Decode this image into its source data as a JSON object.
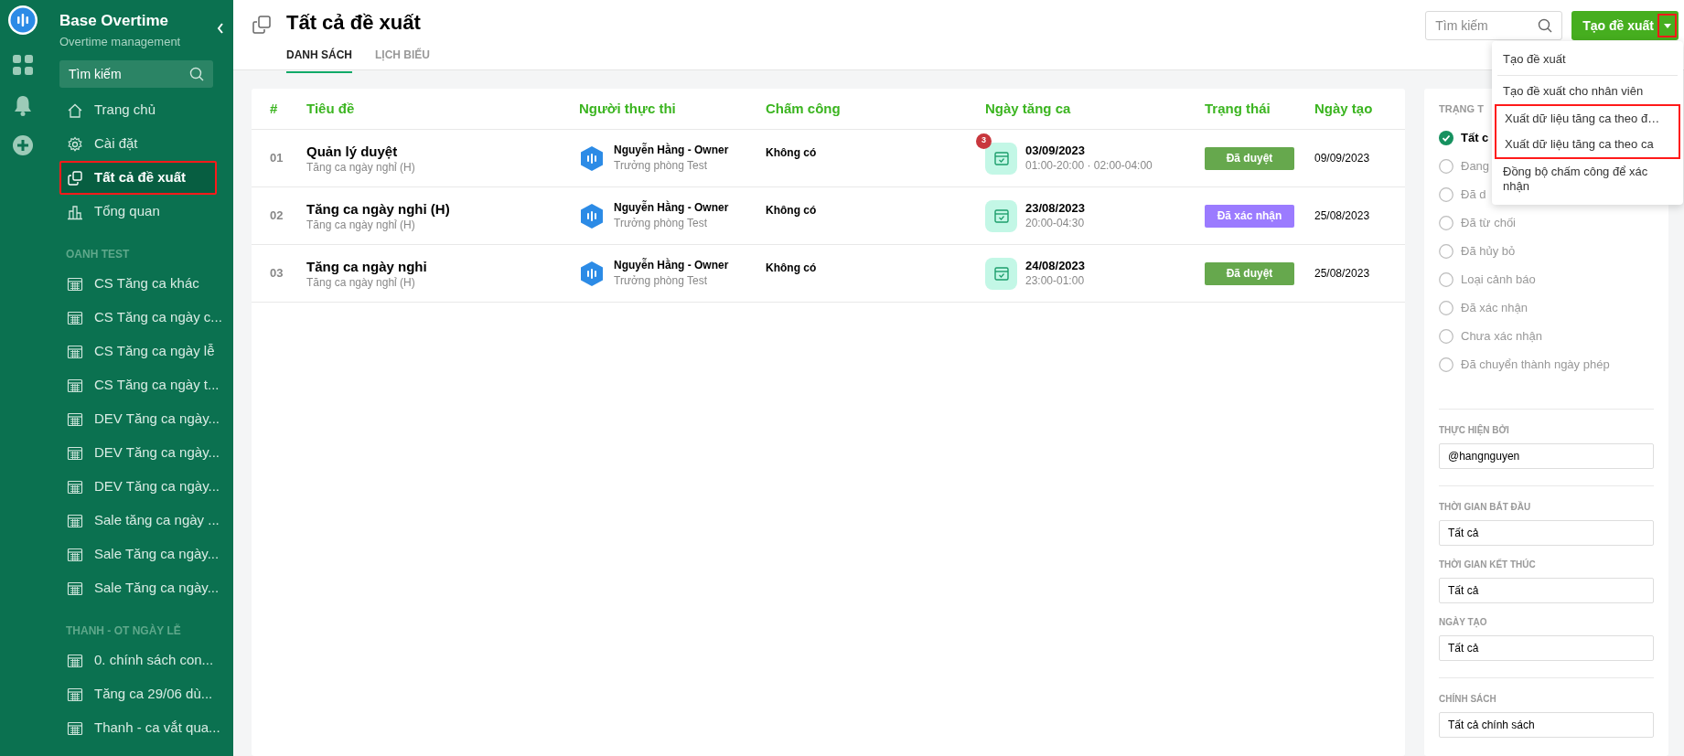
{
  "app": {
    "title": "Base Overtime",
    "subtitle": "Overtime management"
  },
  "sidebar": {
    "search": {
      "placeholder": "Tìm kiếm"
    },
    "nav": [
      {
        "label": "Trang chủ",
        "kind": "home",
        "selected": false,
        "highlighted": false
      },
      {
        "label": "Cài đặt",
        "kind": "gear",
        "selected": false,
        "highlighted": false
      },
      {
        "label": "Tất cả đề xuất",
        "kind": "copy",
        "selected": true,
        "highlighted": true
      },
      {
        "label": "Tổng quan",
        "kind": "chart",
        "selected": false,
        "highlighted": false
      }
    ],
    "sections": [
      {
        "title": "OANH TEST",
        "items": [
          "CS Tăng ca khác",
          "CS Tăng ca ngày c...",
          "CS Tăng ca ngày lễ",
          "CS Tăng ca ngày t...",
          "DEV Tăng ca ngày...",
          "DEV Tăng ca ngày...",
          "DEV Tăng ca ngày...",
          "Sale tăng ca ngày ...",
          "Sale Tăng ca ngày...",
          "Sale Tăng ca ngày..."
        ]
      },
      {
        "title": "THANH - OT NGÀY LỄ",
        "items": [
          "0. chính sách con...",
          "Tăng ca 29/06 dù...",
          "Thanh - ca vắt qua..."
        ]
      }
    ]
  },
  "page": {
    "title": "Tất cả đề xuất",
    "tabs": [
      {
        "label": "DANH SÁCH",
        "selected": true
      },
      {
        "label": "LỊCH BIỂU",
        "selected": false
      }
    ],
    "search": {
      "placeholder": "Tìm kiếm"
    },
    "create_button": {
      "label": "Tạo đề xuất",
      "caret_highlighted": true
    }
  },
  "menu": {
    "groups": [
      [
        {
          "label": "Tạo đề xuất",
          "highlighted": false
        }
      ],
      [
        {
          "label": "Tạo đề xuất cho nhân viên",
          "highlighted": false
        },
        {
          "label": "Xuất dữ liệu tăng ca theo đ…",
          "highlighted": true
        },
        {
          "label": "Xuất dữ liệu tăng ca theo ca",
          "highlighted": true
        },
        {
          "label": "Đồng bộ chấm công để xác nhận",
          "highlighted": false
        }
      ]
    ]
  },
  "table": {
    "columns": [
      "#",
      "Tiêu đề",
      "Người thực thi",
      "Chấm công",
      "Ngày tăng ca",
      "Trạng thái",
      "Ngày tạo"
    ],
    "rows": [
      {
        "index": "01",
        "title": "Quản lý duyệt",
        "subtitle": "Tăng ca ngày nghỉ (H)",
        "assignee": "Nguyễn Hằng - Owner",
        "role": "Trưởng phòng Test",
        "timekeeping": "Không có",
        "date": "03/09/2023",
        "times": "01:00-20:00 · 02:00-04:00",
        "badge": "3",
        "status": {
          "label": "Đã duyệt",
          "kind": "approved"
        },
        "created": "09/09/2023"
      },
      {
        "index": "02",
        "title": "Tăng ca ngày nghỉ (H)",
        "subtitle": "Tăng ca ngày nghỉ (H)",
        "assignee": "Nguyễn Hằng - Owner",
        "role": "Trưởng phòng Test",
        "timekeeping": "Không có",
        "date": "23/08/2023",
        "times": "20:00-04:30",
        "status": {
          "label": "Đã xác nhận",
          "kind": "confirmed"
        },
        "created": "25/08/2023"
      },
      {
        "index": "03",
        "title": "Tăng ca ngày nghỉ",
        "subtitle": "Tăng ca ngày nghỉ (H)",
        "assignee": "Nguyễn Hằng - Owner",
        "role": "Trưởng phòng Test",
        "timekeeping": "Không có",
        "date": "24/08/2023",
        "times": "23:00-01:00",
        "status": {
          "label": "Đã duyệt",
          "kind": "approved"
        },
        "created": "25/08/2023"
      }
    ]
  },
  "filters": {
    "status_title": "TRẠNG T",
    "statuses": [
      {
        "label": "Tất c",
        "selected": true
      },
      {
        "label": "Đang",
        "selected": false
      },
      {
        "label": "Đã d",
        "selected": false
      },
      {
        "label": "Đã từ chối",
        "selected": false
      },
      {
        "label": "Đã hủy bỏ",
        "selected": false
      },
      {
        "label": "Loại cảnh báo",
        "selected": false
      },
      {
        "label": "Đã xác nhận",
        "selected": false
      },
      {
        "label": "Chưa xác nhận",
        "selected": false
      },
      {
        "label": "Đã chuyển thành ngày phép",
        "selected": false
      }
    ],
    "field_groups": [
      [
        {
          "label": "THỰC HIỆN BỞI",
          "value": "@hangnguyen"
        }
      ],
      [
        {
          "label": "THỜI GIAN BẮT ĐẦU",
          "value": "Tất cả"
        },
        {
          "label": "THỜI GIAN KẾT THÚC",
          "value": "Tất cả"
        },
        {
          "label": "NGÀY TẠO",
          "value": "Tất cả"
        }
      ],
      [
        {
          "label": "CHÍNH SÁCH",
          "value": "Tất cả chính sách"
        }
      ]
    ]
  }
}
